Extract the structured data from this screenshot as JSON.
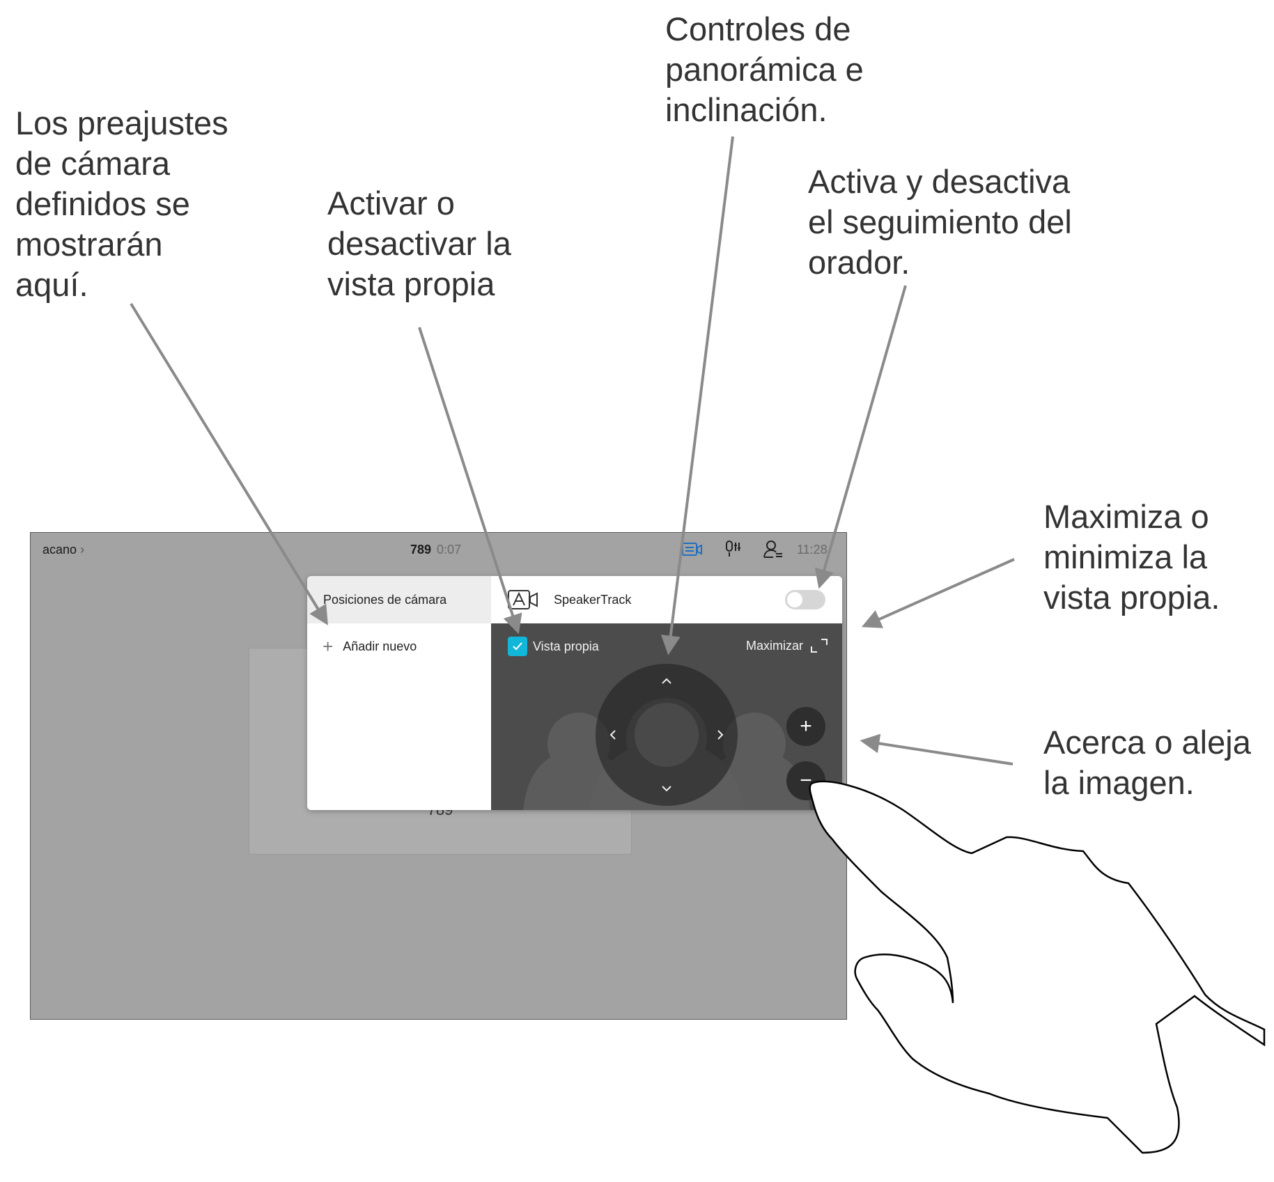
{
  "callouts": {
    "presets": "Los preajustes\nde cámara\ndefinidos se\nmostrarán\naquí.",
    "selfview_toggle": "Activar o\ndesactivar la\nvista propia",
    "pan_tilt": "Controles de\npanorámica e\ninclinación.",
    "speakertrack": "Activa y desactiva\nel seguimiento del\norador.",
    "maximize": "Maximiza o\nminimiza la\nvista propia.",
    "zoom": "Acerca o aleja\nla imagen."
  },
  "status_bar": {
    "call_name": "acano",
    "call_name_chevron": "›",
    "number": "789",
    "duration": "0:07",
    "time": "11:28",
    "icons": [
      "camera-control-icon",
      "microphone-settings-icon",
      "participants-icon"
    ],
    "active_icon_color": "#1f6fc2"
  },
  "remote_tile": {
    "label": "789"
  },
  "camera_panel": {
    "presets_title": "Posiciones de cámara",
    "add_new_label": "Añadir nuevo",
    "speakertrack_label": "SpeakerTrack",
    "speakertrack_on": false,
    "selfview_label": "Vista propia",
    "selfview_checked": true,
    "maximize_label": "Maximizar",
    "zoom_in_symbol": "+",
    "zoom_out_symbol": "−",
    "checkbox_color": "#12b6d8"
  }
}
